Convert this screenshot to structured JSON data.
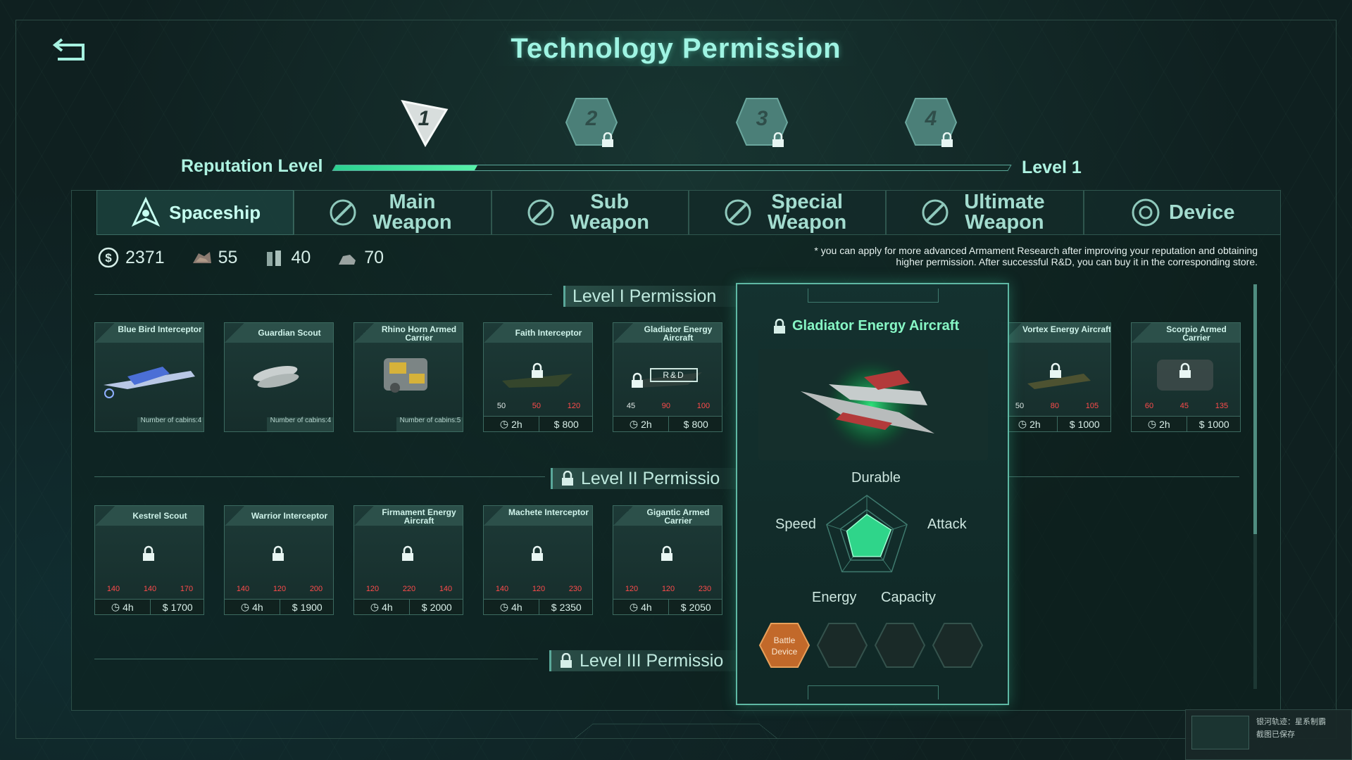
{
  "title": "Technology Permission",
  "reputation": {
    "label": "Reputation Level",
    "level_text": "Level 1",
    "progress_percent": 21,
    "badges": [
      {
        "num": "1",
        "locked": false
      },
      {
        "num": "2",
        "locked": true
      },
      {
        "num": "3",
        "locked": true
      },
      {
        "num": "4",
        "locked": true
      }
    ]
  },
  "tabs": [
    {
      "label": "Spaceship",
      "active": true,
      "icon": "spaceship-icon"
    },
    {
      "label": "Main Weapon",
      "active": false,
      "icon": "weapon-icon"
    },
    {
      "label": "Sub Weapon",
      "active": false,
      "icon": "weapon-icon"
    },
    {
      "label": "Special Weapon",
      "active": false,
      "icon": "weapon-icon"
    },
    {
      "label": "Ultimate Weapon",
      "active": false,
      "icon": "weapon-icon"
    },
    {
      "label": "Device",
      "active": false,
      "icon": "device-icon"
    }
  ],
  "resources": {
    "credits": "2371",
    "ore": "55",
    "crystal": "40",
    "alloy": "70"
  },
  "notice": "* you can apply for more advanced Armament Research after improving your reputation and obtaining higher permission. After successful R&D, you can buy it in the corresponding store.",
  "sections": {
    "level1": "Level I Permission",
    "level2": "Level II Permissio",
    "level3": "Level III Permissio"
  },
  "level1_cards": [
    {
      "name": "Blue Bird Interceptor",
      "cabins": "Number of cabins:4"
    },
    {
      "name": "Guardian Scout",
      "cabins": "Number of cabins:4"
    },
    {
      "name": "Rhino Horn Armed Carrier",
      "cabins": "Number of cabins:5"
    },
    {
      "name": "Faith Interceptor",
      "s1": "50",
      "s2": "50",
      "s3": "120",
      "time": "2h",
      "cost": "800"
    },
    {
      "name": "Gladiator Energy Aircraft",
      "rd": "R&D",
      "s1": "45",
      "s2": "90",
      "s3": "100",
      "time": "2h",
      "cost": "800"
    },
    {
      "name": "Vortex Energy Aircraft",
      "s1": "50",
      "s2": "80",
      "s3": "105",
      "time": "2h",
      "cost": "1000"
    },
    {
      "name": "Scorpio Armed Carrier",
      "s1": "60",
      "s2": "45",
      "s3": "135",
      "time": "2h",
      "cost": "1000"
    }
  ],
  "level2_cards": [
    {
      "name": "Kestrel Scout",
      "s1": "140",
      "s2": "140",
      "s3": "170",
      "time": "4h",
      "cost": "1700"
    },
    {
      "name": "Warrior Interceptor",
      "s1": "140",
      "s2": "120",
      "s3": "200",
      "time": "4h",
      "cost": "1900"
    },
    {
      "name": "Firmament Energy Aircraft",
      "s1": "120",
      "s2": "220",
      "s3": "140",
      "time": "4h",
      "cost": "2000"
    },
    {
      "name": "Machete Interceptor",
      "s1": "140",
      "s2": "120",
      "s3": "230",
      "time": "4h",
      "cost": "2350"
    },
    {
      "name": "Gigantic Armed Carrier",
      "s1": "120",
      "s2": "120",
      "s3": "230",
      "time": "4h",
      "cost": "2050"
    }
  ],
  "detail": {
    "title": "Gladiator Energy Aircraft",
    "radar": {
      "durable": "Durable",
      "attack": "Attack",
      "capacity": "Capacity",
      "energy": "Energy",
      "speed": "Speed",
      "values": {
        "durable": 0.55,
        "attack": 0.6,
        "capacity": 0.55,
        "energy": 0.55,
        "speed": 0.5
      }
    },
    "slot_label": "Battle Device"
  },
  "toast": {
    "line1": "银河轨迹：星系制霸",
    "line2": "截图已保存"
  },
  "colors": {
    "accent": "#57f0a8",
    "locked_red": "#ff4b4b",
    "title": "#9ff4e3"
  }
}
